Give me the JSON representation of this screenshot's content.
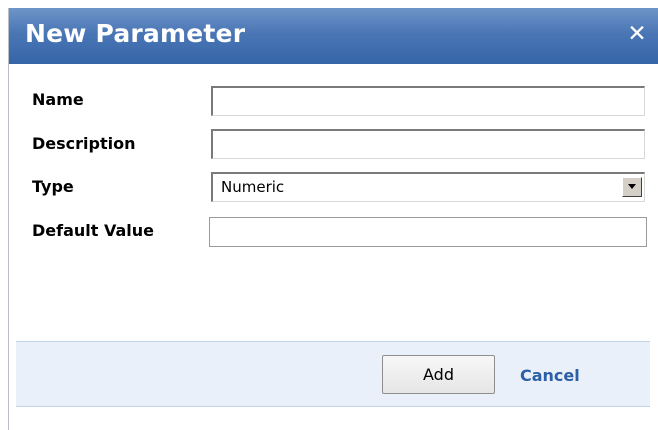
{
  "dialog": {
    "title": "New Parameter",
    "close_symbol": "✕",
    "colors": {
      "titlebar": "#4a76b5",
      "footer": "#eaf0fa",
      "link": "#2b5fa6"
    }
  },
  "form": {
    "name": {
      "label": "Name",
      "value": "",
      "placeholder": ""
    },
    "description": {
      "label": "Description",
      "value": "",
      "placeholder": ""
    },
    "type": {
      "label": "Type",
      "selected": "Numeric"
    },
    "default_value": {
      "label": "Default Value",
      "value": "",
      "placeholder": ""
    }
  },
  "actions": {
    "add_label": "Add",
    "cancel_label": "Cancel"
  },
  "icons": {
    "close": "close-icon",
    "dropdown": "chevron-down-icon"
  }
}
